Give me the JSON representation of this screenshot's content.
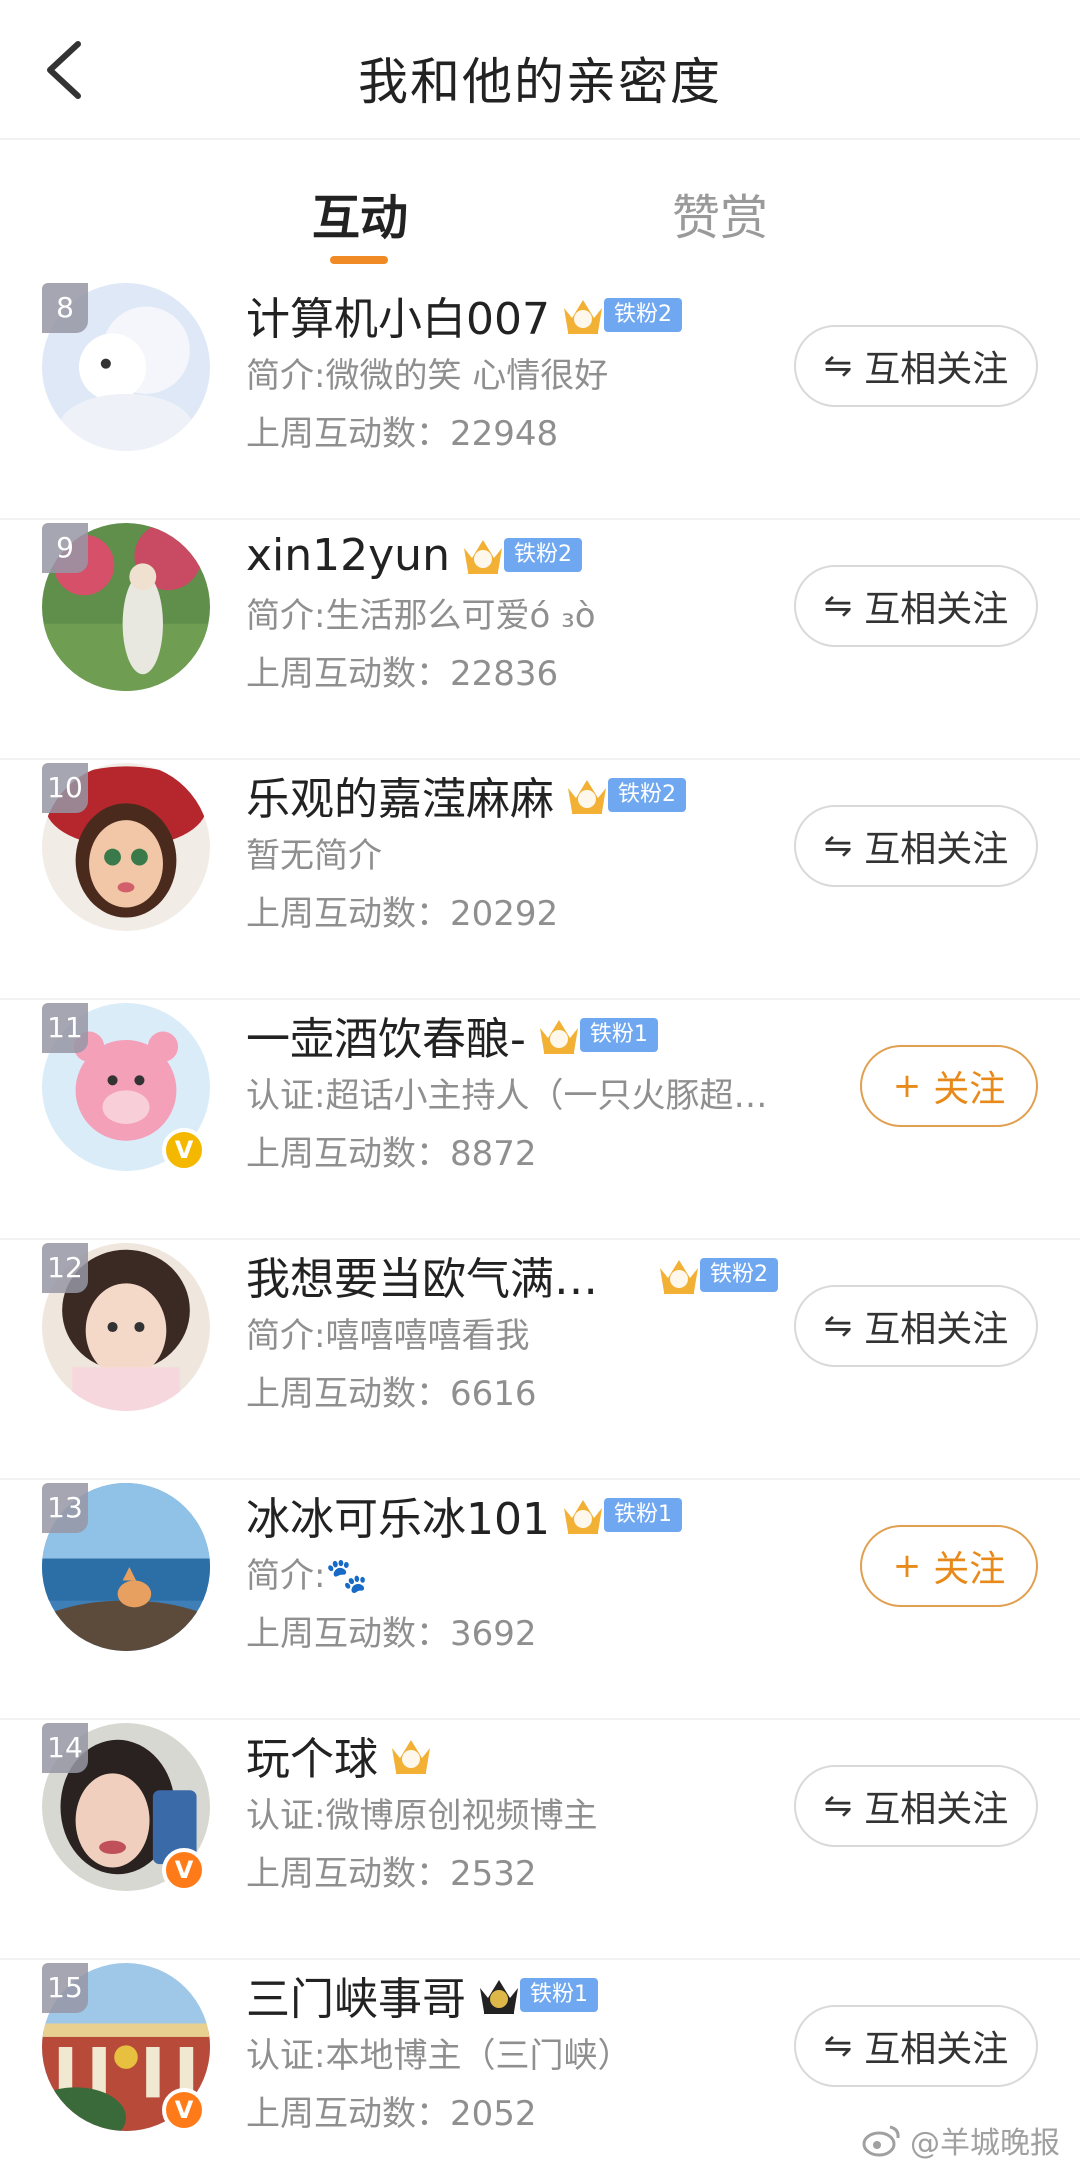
{
  "header": {
    "title": "我和他的亲密度"
  },
  "tabs": [
    {
      "label": "互动",
      "active": true
    },
    {
      "label": "赞赏",
      "active": false
    }
  ],
  "colors": {
    "accent": "#f08a24",
    "follow_text": "#e88a1a",
    "fan_badge": "#6fa8f0",
    "verify_yellow": "#f5b800",
    "verify_orange": "#ff7b1a",
    "crown_gold": "#f2b035",
    "crown_black": "#222222"
  },
  "weekly_prefix": "上周互动数：",
  "users": [
    {
      "rank": "8",
      "name": "计算机小白007",
      "crown_level": "4",
      "crown": "gold",
      "fan_badge": "铁粉2",
      "intro": "简介:微微的笑 心情很好",
      "weekly_count": "22948",
      "button": {
        "type": "mutual",
        "icon": "⇋",
        "label": "互相关注"
      },
      "verified": null,
      "avatar_icon": "cartoon-avatar-icon"
    },
    {
      "rank": "9",
      "name": "xin12yun",
      "crown_level": "6",
      "crown": "gold",
      "fan_badge": "铁粉2",
      "intro": "简介:生活那么可爱ó ₃ò",
      "weekly_count": "22836",
      "button": {
        "type": "mutual",
        "icon": "⇋",
        "label": "互相关注"
      },
      "verified": null,
      "avatar_icon": "garden-avatar-icon"
    },
    {
      "rank": "10",
      "name": "乐观的嘉滢麻麻",
      "crown_level": "2",
      "crown": "gold",
      "fan_badge": "铁粉2",
      "intro": "暂无简介",
      "weekly_count": "20292",
      "button": {
        "type": "mutual",
        "icon": "⇋",
        "label": "互相关注"
      },
      "verified": null,
      "avatar_icon": "girl-cartoon-avatar-icon"
    },
    {
      "rank": "11",
      "name": "一壶酒饮春酿-",
      "crown_level": "6",
      "crown": "gold",
      "fan_badge": "铁粉1",
      "intro": "认证:超话小主持人（一只火豚超…",
      "weekly_count": "8872",
      "button": {
        "type": "follow",
        "icon": "+",
        "label": "关注"
      },
      "verified": "yellow",
      "avatar_icon": "pink-bear-avatar-icon"
    },
    {
      "rank": "12",
      "name": "我想要当欧气满…",
      "crown_level": "6",
      "crown": "gold",
      "fan_badge": "铁粉2",
      "intro": "简介:嘻嘻嘻嘻看我",
      "weekly_count": "6616",
      "button": {
        "type": "mutual",
        "icon": "⇋",
        "label": "互相关注"
      },
      "verified": null,
      "avatar_icon": "selfie-avatar-icon",
      "wide_gap": true
    },
    {
      "rank": "13",
      "name": "冰冰可乐冰101",
      "crown_level": "6",
      "crown": "gold",
      "fan_badge": "铁粉1",
      "intro": "简介:🐾",
      "weekly_count": "3692",
      "button": {
        "type": "follow",
        "icon": "+",
        "label": "关注"
      },
      "verified": null,
      "avatar_icon": "fox-sea-avatar-icon"
    },
    {
      "rank": "14",
      "name": "玩个球",
      "crown_level": "2",
      "crown": "gold",
      "fan_badge": null,
      "intro": "认证:微博原创视频博主",
      "weekly_count": "2532",
      "button": {
        "type": "mutual",
        "icon": "⇋",
        "label": "互相关注"
      },
      "verified": "orange",
      "avatar_icon": "crying-girl-avatar-icon"
    },
    {
      "rank": "15",
      "name": "三门峡事哥",
      "crown_level": "1",
      "crown": "black",
      "fan_badge": "铁粉1",
      "intro": "认证:本地博主（三门峡）",
      "weekly_count": "2052",
      "button": {
        "type": "mutual",
        "icon": "⇋",
        "label": "互相关注"
      },
      "verified": "orange",
      "avatar_icon": "building-avatar-icon"
    }
  ],
  "watermark": "@羊城晚报"
}
